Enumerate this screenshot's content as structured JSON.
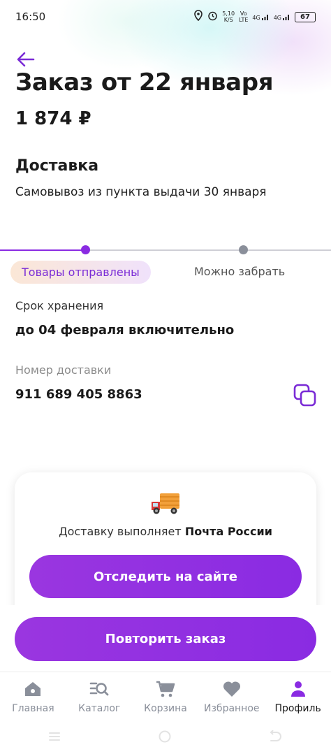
{
  "status_bar": {
    "time": "16:50",
    "net_speed_top": "5,10",
    "net_speed_bottom": "K/S",
    "volte_top": "Vo",
    "volte_bottom": "LTE",
    "sig1": "4G",
    "sig2": "4G",
    "battery": "67"
  },
  "header": {
    "title": "Заказ от 22 января",
    "price": "1 874 ₽"
  },
  "delivery": {
    "heading": "Доставка",
    "subtitle": "Самовывоз из пункта выдачи 30 января"
  },
  "progress": {
    "current_step": "Товары отправлены",
    "next_step": "Можно забрать"
  },
  "storage": {
    "label": "Срок хранения",
    "value": "до 04 февраля включительно"
  },
  "tracking": {
    "label": "Номер доставки",
    "number": "911 689 405 8863"
  },
  "carrier_card": {
    "text": "Доставку выполняет",
    "carrier_name": "Почта России",
    "track_button": "Отследить на сайте"
  },
  "repeat_button": "Повторить заказ",
  "tabbar": {
    "items": [
      {
        "label": "Главная",
        "icon": "home-icon"
      },
      {
        "label": "Каталог",
        "icon": "catalog-search-icon"
      },
      {
        "label": "Корзина",
        "icon": "cart-icon"
      },
      {
        "label": "Избранное",
        "icon": "heart-icon"
      },
      {
        "label": "Профиль",
        "icon": "profile-icon"
      }
    ]
  },
  "colors": {
    "accent": "#8a2be2",
    "inactive_icon": "#8a8f9a"
  }
}
